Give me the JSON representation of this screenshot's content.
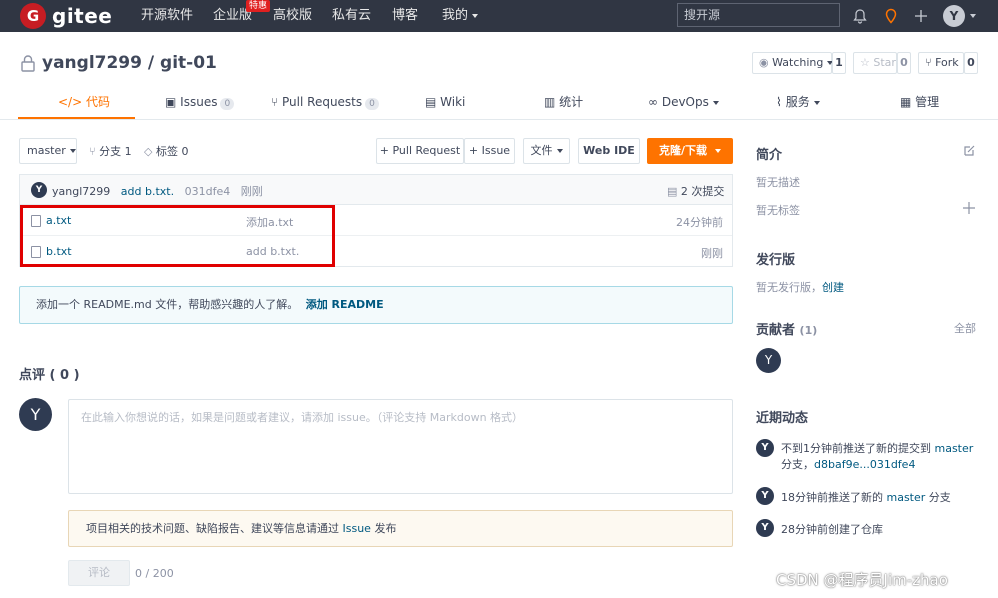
{
  "topnav": {
    "logo_letter": "G",
    "logo_text": "gitee",
    "items": [
      "开源软件",
      "企业版",
      "高校版",
      "私有云",
      "博客",
      "我的"
    ],
    "hot_badge": "特惠",
    "search_placeholder": "搜开源",
    "user_initial": "Y"
  },
  "repo": {
    "owner": "yangl7299",
    "separator": "/",
    "name": "git-01",
    "watch_label": "Watching",
    "watch_count": "1",
    "star_label": "Star",
    "star_count": "0",
    "fork_label": "Fork",
    "fork_count": "0"
  },
  "tabs": [
    {
      "label": "代码"
    },
    {
      "label": "Issues",
      "count": "0"
    },
    {
      "label": "Pull Requests",
      "count": "0"
    },
    {
      "label": "Wiki"
    },
    {
      "label": "统计"
    },
    {
      "label": "DevOps"
    },
    {
      "label": "服务"
    },
    {
      "label": "管理"
    }
  ],
  "toolbar": {
    "branch": "master",
    "branches": "分支 1",
    "tags": "标签 0",
    "pull_request": "+ Pull Request",
    "issue": "+ Issue",
    "file_menu": "文件",
    "web_ide": "Web IDE",
    "clone": "克隆/下载"
  },
  "last_commit": {
    "avatar": "Y",
    "author": "yangl7299",
    "message": "add b.txt.",
    "hash": "031dfe4",
    "time": "刚刚",
    "commits": "2 次提交"
  },
  "files": [
    {
      "name": "a.txt",
      "message": "添加a.txt",
      "time": "24分钟前"
    },
    {
      "name": "b.txt",
      "message": "add b.txt.",
      "time": "刚刚"
    }
  ],
  "readme_tip": {
    "text": "添加一个 README.md 文件，帮助感兴趣的人了解。",
    "link": "添加 README"
  },
  "comments": {
    "title": "点评 ( 0 )",
    "avatar": "Y",
    "placeholder": "在此输入你想说的话，如果是问题或者建议，请添加 issue。（评论支持 Markdown 格式）",
    "notice_text": "项目相关的技术问题、缺陷报告、建议等信息请通过 ",
    "notice_link": "Issue",
    "notice_suffix": " 发布",
    "submit": "评论",
    "counter": "0 / 200"
  },
  "sidebar": {
    "intro_title": "简介",
    "no_desc": "暂无描述",
    "no_tags": "暂无标签",
    "release_title": "发行版",
    "no_release": "暂无发行版，",
    "create": "创建",
    "contrib_title": "贡献者",
    "contrib_count": "(1)",
    "all": "全部",
    "contrib_avatar": "Y",
    "activity_title": "近期动态",
    "activities": [
      {
        "avatar": "Y",
        "prefix": "不到1分钟前推送了新的提交到 ",
        "branch": "master",
        "line2_prefix": "分支，",
        "range": "d8baf9e...031dfe4"
      },
      {
        "avatar": "Y",
        "prefix": "18分钟前推送了新的 ",
        "branch": "master",
        "suffix": " 分支"
      },
      {
        "avatar": "Y",
        "text": "28分钟前创建了仓库"
      }
    ]
  },
  "watermark": "CSDN @程序员Jim-zhao",
  "colors": {
    "nav_bg": "#303643",
    "accent": "#fe7300",
    "brand": "#c71d23",
    "link": "#005980",
    "highlight_frame": "#e00000"
  }
}
